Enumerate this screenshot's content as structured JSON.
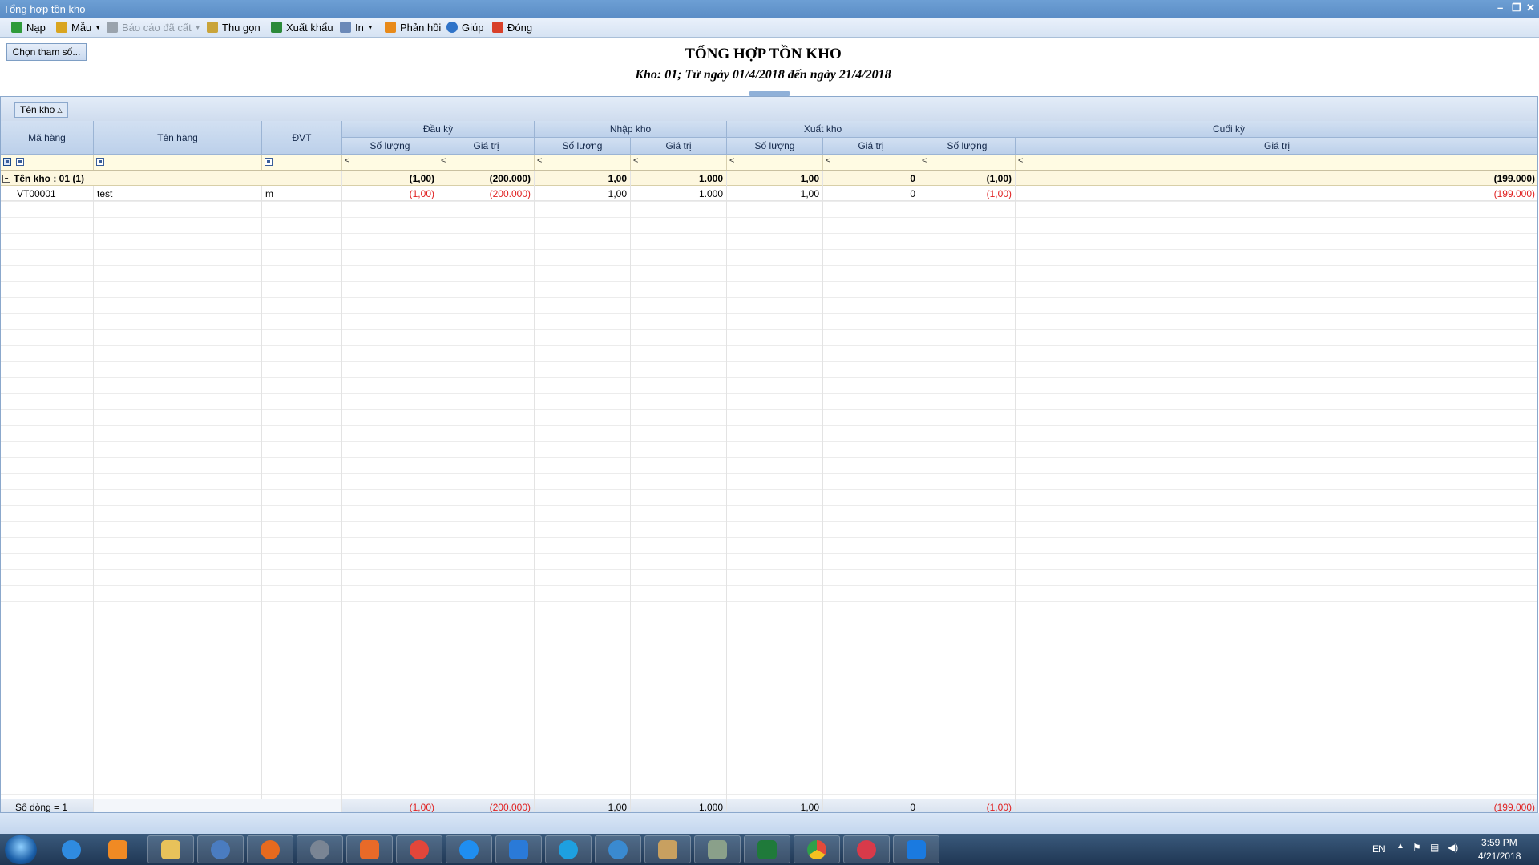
{
  "window": {
    "title": "Tổng hợp tồn kho"
  },
  "toolbar": {
    "items": [
      {
        "label": "Nạp",
        "icon": "refresh-icon",
        "color": "#2f9b3a",
        "disabled": false
      },
      {
        "label": "Mẫu",
        "icon": "chart-icon",
        "color": "#d9a520",
        "disabled": false,
        "dropdown": true
      },
      {
        "label": "Báo cáo đã cất",
        "icon": "save-icon",
        "color": "#9aa3ad",
        "disabled": true,
        "dropdown": true
      },
      {
        "label": "Thu gọn",
        "icon": "collapse-icon",
        "color": "#c9a43a",
        "disabled": false
      },
      {
        "label": "Xuất khẩu",
        "icon": "excel-icon",
        "color": "#2c8a3a",
        "disabled": false
      },
      {
        "label": "In",
        "icon": "printer-icon",
        "color": "#6b89b8",
        "disabled": false,
        "dropdown": true
      },
      {
        "label": "Phản hồi",
        "icon": "envelope-icon",
        "color": "#e88a1a",
        "disabled": false
      },
      {
        "label": "Giúp",
        "icon": "help-icon",
        "color": "#2f73c8",
        "disabled": false
      },
      {
        "label": "Đóng",
        "icon": "close-icon",
        "color": "#d8402a",
        "disabled": false
      }
    ]
  },
  "params_button": "Chọn tham số...",
  "report": {
    "title": "TỔNG HỢP TỒN KHO",
    "subtitle": "Kho: 01; Từ ngày 01/4/2018 đến ngày 21/4/2018"
  },
  "grid": {
    "group_tag": "Tên kho",
    "headers": {
      "ma_hang": "Mã hàng",
      "ten_hang": "Tên hàng",
      "dvt": "ĐVT",
      "dau_ky": "Đầu kỳ",
      "nhap_kho": "Nhập kho",
      "xuat_kho": "Xuất kho",
      "cuoi_ky": "Cuối kỳ",
      "so_luong": "Số lượng",
      "gia_tri": "Giá trị"
    },
    "filter_symbol": "≤",
    "group_row": {
      "label": "Tên kho : 01 (1)",
      "dk_sl": "(1,00)",
      "dk_gt": "(200.000)",
      "nk_sl": "1,00",
      "nk_gt": "1.000",
      "xk_sl": "1,00",
      "xk_gt": "0",
      "ck_sl": "(1,00)",
      "ck_gt": "(199.000)"
    },
    "rows": [
      {
        "ma_hang": "VT00001",
        "ten_hang": "test",
        "dvt": "m",
        "dk_sl": "(1,00)",
        "dk_gt": "(200.000)",
        "nk_sl": "1,00",
        "nk_gt": "1.000",
        "xk_sl": "1,00",
        "xk_gt": "0",
        "ck_sl": "(1,00)",
        "ck_gt": "(199.000)"
      }
    ],
    "footer": {
      "count": "Số dòng = 1",
      "dk_sl": "(1,00)",
      "dk_gt": "(200.000)",
      "nk_sl": "1,00",
      "nk_gt": "1.000",
      "xk_sl": "1,00",
      "xk_gt": "0",
      "ck_sl": "(1,00)",
      "ck_gt": "(199.000)"
    }
  },
  "taskbar": {
    "apps": [
      "internet-explorer",
      "media-player",
      "file-explorer",
      "outlook",
      "firefox",
      "headset",
      "misa",
      "lifebuoy",
      "zalo",
      "database",
      "skype",
      "remote-desktop",
      "paint",
      "calculator",
      "excel",
      "chrome",
      "ultraviewer",
      "teamviewer"
    ],
    "language": "EN",
    "time": "3:59 PM",
    "date": "4/21/2018"
  },
  "colors": {
    "negative": "#e02020",
    "header": "#c8d9ee",
    "filter_row": "#fffbe3",
    "title_bar": "#5b8dc6"
  }
}
